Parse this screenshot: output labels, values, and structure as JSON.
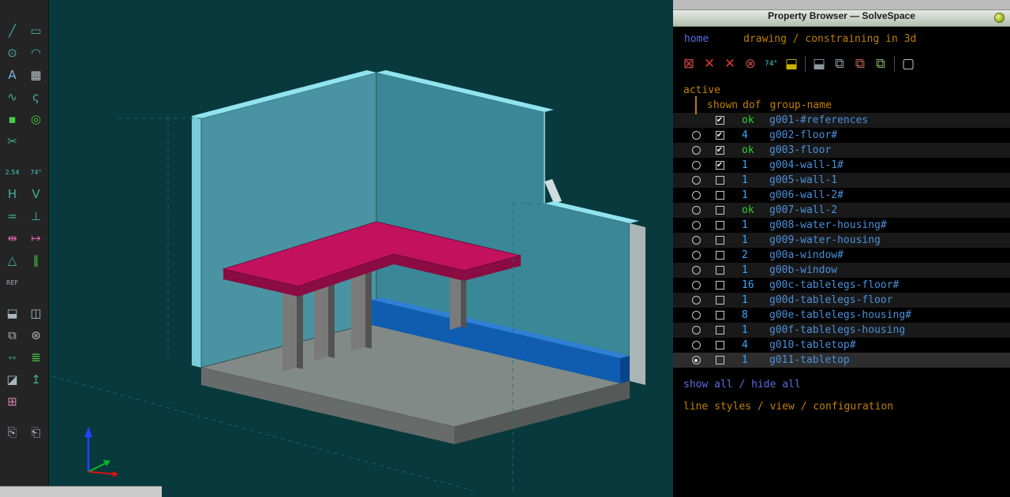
{
  "window": {
    "title": "Property Browser — SolveSpace"
  },
  "nav": {
    "home": "home",
    "path": "drawing / constraining in 3d"
  },
  "panel_toolbar": [
    {
      "name": "workplane-icon",
      "glyph": "⊠",
      "color": "#cc4444"
    },
    {
      "name": "point-constraint-icon",
      "glyph": "✕",
      "color": "#dd3333"
    },
    {
      "name": "midpoint-constraint-icon",
      "glyph": "✕",
      "color": "#dd3333"
    },
    {
      "name": "circle-constraint-icon",
      "glyph": "⊗",
      "color": "#bb4444"
    },
    {
      "name": "angle-constraint-icon",
      "glyph": "74°",
      "color": "#3fc8c8",
      "small": true
    },
    {
      "name": "extrude-icon",
      "glyph": "⬓",
      "color": "#c8b400"
    },
    {
      "divider": true
    },
    {
      "name": "lathe-icon",
      "glyph": "⬓",
      "color": "#8a9aa0"
    },
    {
      "name": "translate-icon",
      "glyph": "⧉",
      "color": "#8a9aa0"
    },
    {
      "name": "rotate-icon",
      "glyph": "⧉",
      "color": "#bb6655"
    },
    {
      "name": "link-icon",
      "glyph": "⧉",
      "color": "#7fb069"
    },
    {
      "divider": true
    },
    {
      "name": "mesh-view-icon",
      "glyph": "▢",
      "color": "#d0d0d0"
    }
  ],
  "browser": {
    "active_label": "active",
    "headers": [
      "shown",
      "dof",
      "group-name"
    ],
    "rows": [
      {
        "radio": false,
        "checked": true,
        "active": false,
        "dof": "ok",
        "name": "g001-#references"
      },
      {
        "radio": true,
        "checked": true,
        "active": false,
        "dof": "4",
        "name": "g002-floor#"
      },
      {
        "radio": true,
        "checked": true,
        "active": false,
        "dof": "ok",
        "name": "g003-floor"
      },
      {
        "radio": true,
        "checked": true,
        "active": false,
        "dof": "1",
        "name": "g004-wall-1#"
      },
      {
        "radio": true,
        "checked": false,
        "active": false,
        "dof": "1",
        "name": "g005-wall-1"
      },
      {
        "radio": true,
        "checked": false,
        "active": false,
        "dof": "1",
        "name": "g006-wall-2#"
      },
      {
        "radio": true,
        "checked": false,
        "active": false,
        "dof": "ok",
        "name": "g007-wall-2"
      },
      {
        "radio": true,
        "checked": false,
        "active": false,
        "dof": "1",
        "name": "g008-water-housing#"
      },
      {
        "radio": true,
        "checked": false,
        "active": false,
        "dof": "1",
        "name": "g009-water-housing"
      },
      {
        "radio": true,
        "checked": false,
        "active": false,
        "dof": "2",
        "name": "g00a-window#"
      },
      {
        "radio": true,
        "checked": false,
        "active": false,
        "dof": "1",
        "name": "g00b-window"
      },
      {
        "radio": true,
        "checked": false,
        "active": false,
        "dof": "16",
        "name": "g00c-tablelegs-floor#"
      },
      {
        "radio": true,
        "checked": false,
        "active": false,
        "dof": "1",
        "name": "g00d-tablelegs-floor"
      },
      {
        "radio": true,
        "checked": false,
        "active": false,
        "dof": "8",
        "name": "g00e-tablelegs-housing#"
      },
      {
        "radio": true,
        "checked": false,
        "active": false,
        "dof": "1",
        "name": "g00f-tablelegs-housing"
      },
      {
        "radio": true,
        "checked": false,
        "active": false,
        "dof": "4",
        "name": "g010-tabletop#"
      },
      {
        "radio": true,
        "checked": false,
        "active": true,
        "dof": "1",
        "name": "g011-tabletop"
      }
    ],
    "links": {
      "show_hide": "show all / hide all",
      "config": "line styles / view / configuration"
    }
  },
  "left_toolbar": {
    "groups": [
      [
        {
          "name": "line-tool-icon",
          "glyph": "╱",
          "color": "#3fae9e"
        },
        {
          "name": "rectangle-tool-icon",
          "glyph": "▭",
          "color": "#3fae9e"
        },
        {
          "name": "circle-tool-icon",
          "glyph": "⊙",
          "color": "#3fae9e"
        },
        {
          "name": "arc-tool-icon",
          "glyph": "◠",
          "color": "#3fae9e"
        },
        {
          "name": "text-tool-icon",
          "glyph": "A",
          "color": "#7bb3e0"
        },
        {
          "name": "image-tool-icon",
          "glyph": "▦",
          "color": "#b8c4c4"
        },
        {
          "name": "bezier-tool-icon",
          "glyph": "∿",
          "color": "#3fae9e"
        },
        {
          "name": "tangent-arc-tool-icon",
          "glyph": "ς",
          "color": "#3fae9e"
        },
        {
          "name": "point-tool-icon",
          "glyph": "▪",
          "color": "#44cc44"
        },
        {
          "name": "construction-tool-icon",
          "glyph": "◎",
          "color": "#44cc44"
        },
        {
          "name": "split-curves-tool-icon",
          "glyph": "✂",
          "color": "#3fae9e"
        }
      ],
      [
        {
          "name": "distance-constraint-icon",
          "glyph": "2.54",
          "color": "#3fc8c8",
          "small": true
        },
        {
          "name": "angle-constraint-icon",
          "glyph": "74°",
          "color": "#3fc8c8",
          "small": true
        },
        {
          "name": "horizontal-constraint-icon",
          "glyph": "H",
          "color": "#3fae9e"
        },
        {
          "name": "vertical-constraint-icon",
          "glyph": "V",
          "color": "#3fae9e"
        },
        {
          "name": "equal-constraint-icon",
          "glyph": "=",
          "color": "#3fae9e"
        },
        {
          "name": "perpendicular-constraint-icon",
          "glyph": "⊥",
          "color": "#3fae9e"
        },
        {
          "name": "symmetric-constraint-icon",
          "glyph": "⇹",
          "color": "#d863a8"
        },
        {
          "name": "coincident-constraint-icon",
          "glyph": "↦",
          "color": "#d863a8"
        },
        {
          "name": "orientation-constraint-icon",
          "glyph": "△",
          "color": "#3fae9e"
        },
        {
          "name": "parallel-constraint-icon",
          "glyph": "∥",
          "color": "#44cc44"
        },
        {
          "name": "reference-constraint-icon",
          "glyph": "REF",
          "color": "#9fb0c0",
          "small": true
        }
      ],
      [
        {
          "name": "extrude-group-icon",
          "glyph": "⬓",
          "color": "#a8b8c0"
        },
        {
          "name": "lathe-group-icon",
          "glyph": "◫",
          "color": "#a8b8c0"
        },
        {
          "name": "translate-group-icon",
          "glyph": "⧉",
          "color": "#a8b8c0"
        },
        {
          "name": "rotate-group-icon",
          "glyph": "⊛",
          "color": "#a8b8c0"
        },
        {
          "name": "step-translate-group-icon",
          "glyph": "⋄⋄",
          "color": "#3fae9e",
          "small": true
        },
        {
          "name": "step-rotate-group-icon",
          "glyph": "≣",
          "color": "#44cc44"
        },
        {
          "name": "new-sketch-group-icon",
          "glyph": "◪",
          "color": "#a8b8c0"
        },
        {
          "name": "normal-tool-icon",
          "glyph": "↥",
          "color": "#3fae9e"
        },
        {
          "name": "link-group-icon",
          "glyph": "⊞",
          "color": "#d882b8"
        }
      ],
      [
        {
          "name": "copy-sheet-icon",
          "glyph": "⎘",
          "color": "#a8b8c0"
        },
        {
          "name": "paste-sheet-icon",
          "glyph": "⎗",
          "color": "#a8b8c0"
        }
      ]
    ]
  },
  "scene": {
    "background": "#08393d",
    "colors": {
      "wall_left": "#4a93a2",
      "wall_right": "#3a8897",
      "wall_top": "#90e4ef",
      "wall_edge": "#79cdd9",
      "wall_endcap": "#aab6b6",
      "step_cap": "#cfdde0",
      "floor_top": "#828a87",
      "floor_front_left": "#676c6a",
      "floor_front_right": "#555a58",
      "beam_top": "#2e7fd6",
      "beam_front": "#0f5cb0",
      "beam_end": "#0a4488",
      "table_top": "#c2125e",
      "table_edge": "#8a0c42",
      "leg_front": "#7a7a7a",
      "leg_side": "#525252",
      "axis_x": "#e01010",
      "axis_y": "#00bb22",
      "axis_z": "#2244ff",
      "construction": "#17706d"
    }
  }
}
